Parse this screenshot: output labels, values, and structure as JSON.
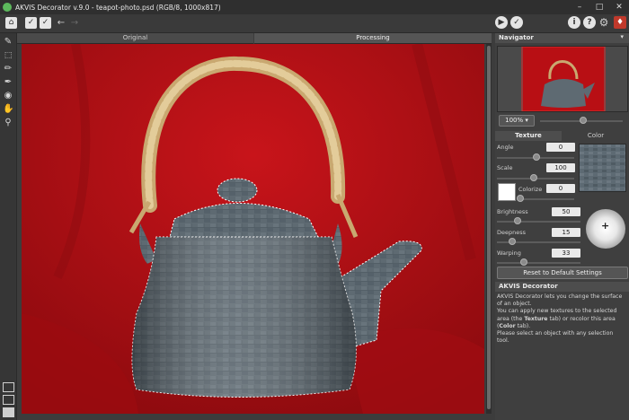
{
  "window": {
    "title": "AKVIS Decorator v.9.0 - teapot-photo.psd (RGB/8, 1000x817)",
    "minimize_icon": "minimize-icon",
    "maximize_icon": "maximize-icon",
    "close_icon": "close-icon"
  },
  "toolbar": {
    "left_icons": [
      "home-icon",
      "apply-check-icon",
      "save-check-icon",
      "undo-icon",
      "redo-icon"
    ],
    "right_icons": [
      "run-icon",
      "apply-icon",
      "info-icon",
      "help-icon",
      "settings-icon",
      "gift-icon"
    ]
  },
  "tools": [
    "eraser-icon",
    "selection-icon",
    "pencil-icon",
    "brush-icon",
    "fill-icon",
    "hand-icon",
    "zoom-icon"
  ],
  "tabs": {
    "original": "Original",
    "processing": "Processing"
  },
  "navigator": {
    "title": "Navigator",
    "zoom": "100%"
  },
  "settings": {
    "tab_texture": "Texture",
    "tab_color": "Color",
    "angle_label": "Angle",
    "angle_value": "0",
    "scale_label": "Scale",
    "scale_value": "100",
    "colorize_label": "Colorize",
    "colorize_value": "0",
    "brightness_label": "Brightness",
    "brightness_value": "50",
    "deepness_label": "Deepness",
    "deepness_value": "15",
    "warping_label": "Warping",
    "warping_value": "33",
    "reset_label": "Reset to Default Settings"
  },
  "info": {
    "title": "AKVIS Decorator",
    "line1": "AKVIS Decorator lets you change the surface of an object.",
    "line2a": "You can apply new textures to the selected area (the ",
    "line2b": "Texture",
    "line2c": " tab) or recolor this area (",
    "line2d": "Color",
    "line2e": " tab).",
    "line3": "Please select an object with any selection tool."
  },
  "colors": {
    "background": "#b80f14",
    "panel": "#3f3f3f",
    "texture": "#5d6a73"
  }
}
